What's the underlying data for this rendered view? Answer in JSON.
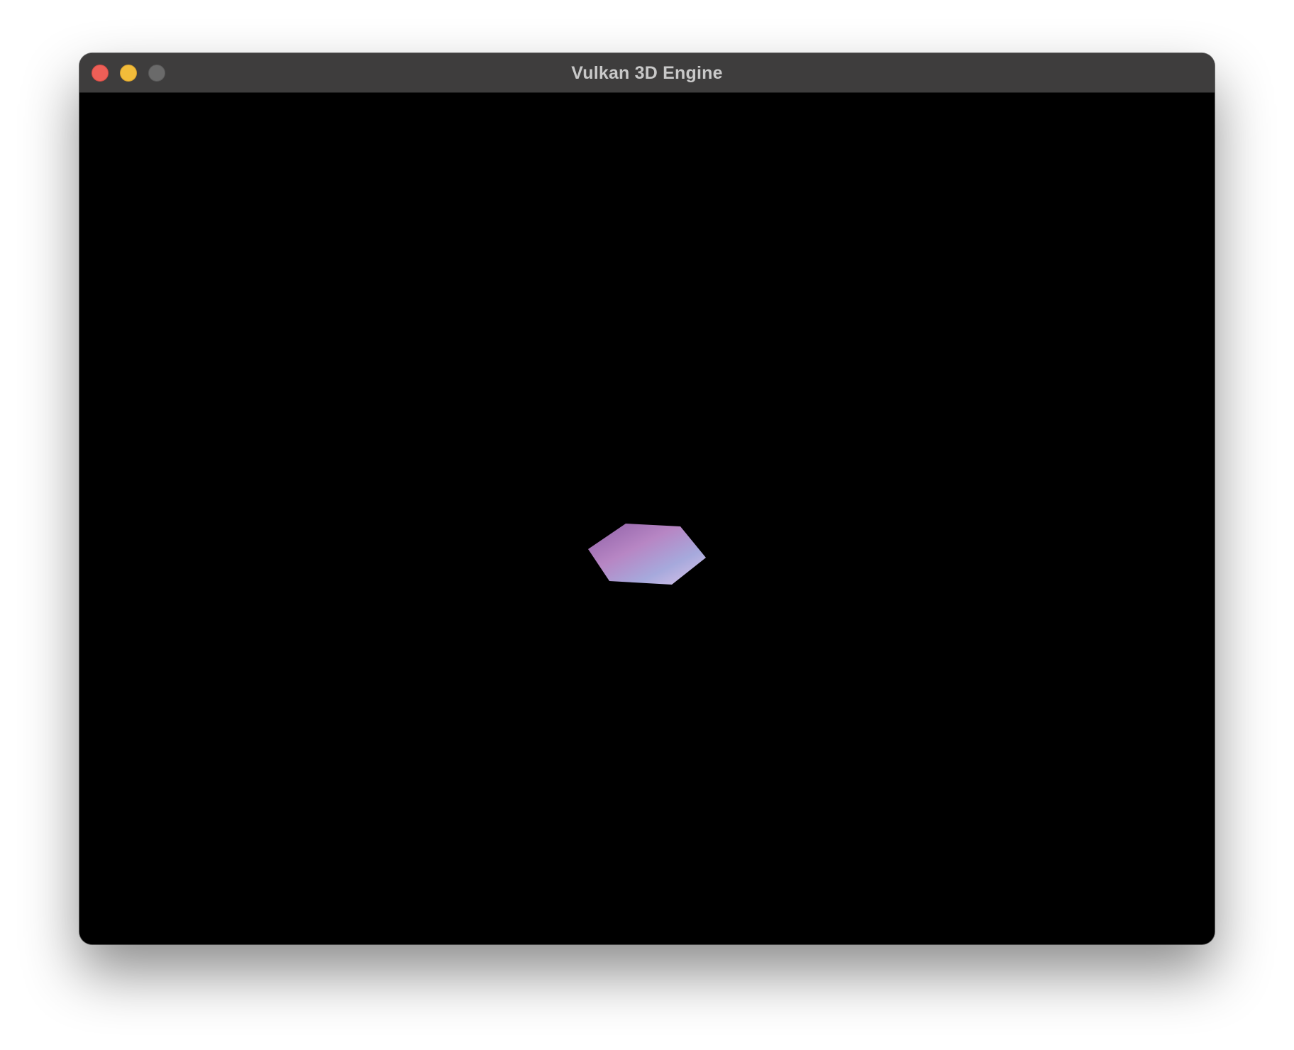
{
  "window": {
    "title": "Vulkan 3D Engine",
    "controls": {
      "close_color": "#ee5f57",
      "minimize_color": "#f2bc3a",
      "zoom_color": "#6a6a6a"
    }
  },
  "viewport": {
    "background": "#000000",
    "object": {
      "shape": "hexagon",
      "gradient_colors": [
        "#8e5fa6",
        "#b786c4",
        "#a6a9dc",
        "#dec4ea"
      ]
    }
  }
}
